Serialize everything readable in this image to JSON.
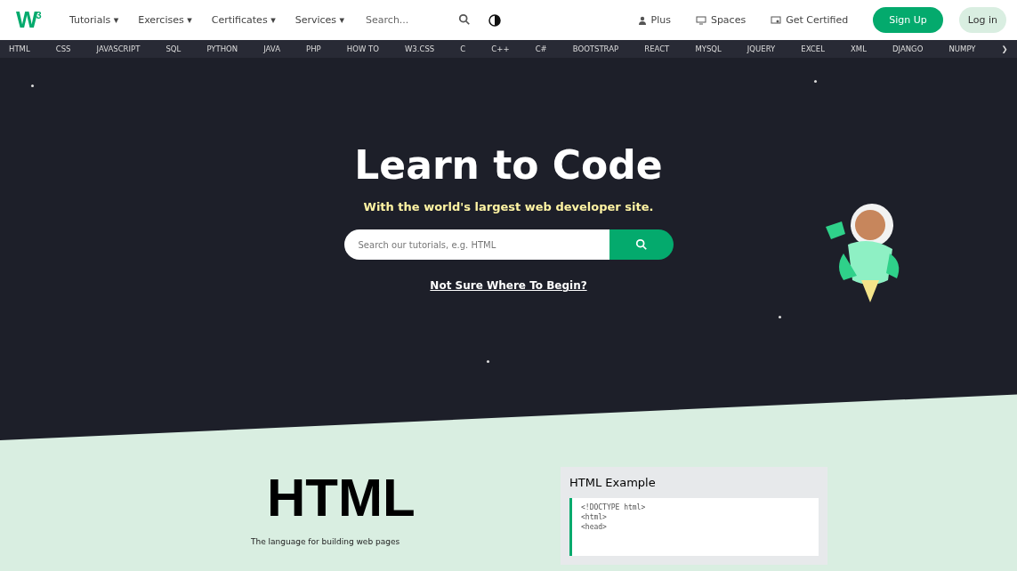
{
  "topbar": {
    "logo": "W$^{3}$",
    "menus": [
      {
        "label": "Tutorials",
        "caret": "▾"
      },
      {
        "label": "Exercises",
        "caret": "▾"
      },
      {
        "label": "Certificates",
        "caret": "▾"
      },
      {
        "label": "Services",
        "caret": "▾"
      }
    ],
    "search": {
      "placeholder": "Search..."
    },
    "links": [
      {
        "kind": "plus",
        "label": "Plus"
      },
      {
        "kind": "spaces",
        "label": "Spaces"
      },
      {
        "kind": "cert",
        "label": "Get Certified"
      }
    ],
    "signup": "Sign Up",
    "login": "Log in"
  },
  "subnav": {
    "items": [
      "HTML",
      "CSS",
      "JAVASCRIPT",
      "SQL",
      "PYTHON",
      "JAVA",
      "PHP",
      "HOW TO",
      "W3.CSS",
      "C",
      "C++",
      "C#",
      "BOOTSTRAP",
      "REACT",
      "MYSQL",
      "JQUERY",
      "EXCEL",
      "XML",
      "DJANGO",
      "NUMPY"
    ],
    "more": "❯"
  },
  "hero": {
    "title": "Learn to Code",
    "subtitle": "With the world's largest web developer site.",
    "search": {
      "placeholder": "Search our tutorials, e.g. HTML"
    },
    "begin_link": "Not Sure Where To Begin?"
  },
  "html_section": {
    "title": "HTML",
    "tagline": "The language for building web pages",
    "example": {
      "title": "HTML Example",
      "code": [
        "<!DOCTYPE html>",
        "<html>",
        "<head>"
      ]
    }
  }
}
